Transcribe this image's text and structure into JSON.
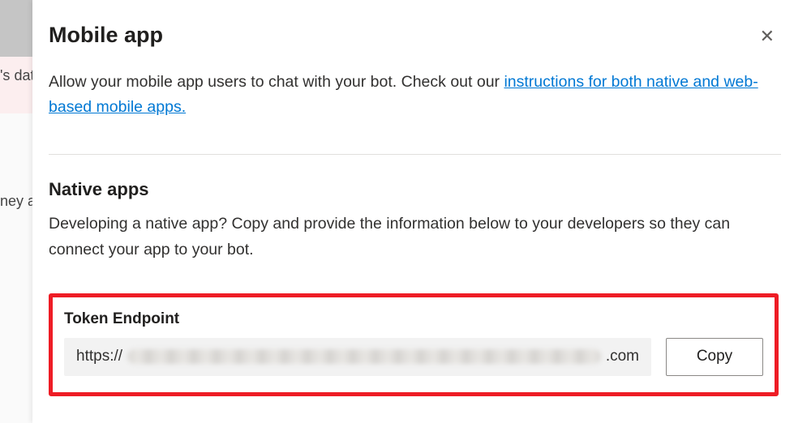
{
  "background": {
    "cutoff_text_top": "'s dat",
    "cutoff_text_mid": "ney a"
  },
  "panel": {
    "title": "Mobile app",
    "close_glyph": "✕",
    "lead_prefix": "Allow your mobile app users to chat with your bot. Check out our ",
    "lead_link": "instructions for both native and web-based mobile apps.",
    "native": {
      "heading": "Native apps",
      "desc": "Developing a native app? Copy and provide the information below to your developers so they can connect your app to your bot."
    },
    "token": {
      "label": "Token Endpoint",
      "value_prefix": "https://",
      "value_suffix": ".com",
      "copy_label": "Copy"
    }
  }
}
